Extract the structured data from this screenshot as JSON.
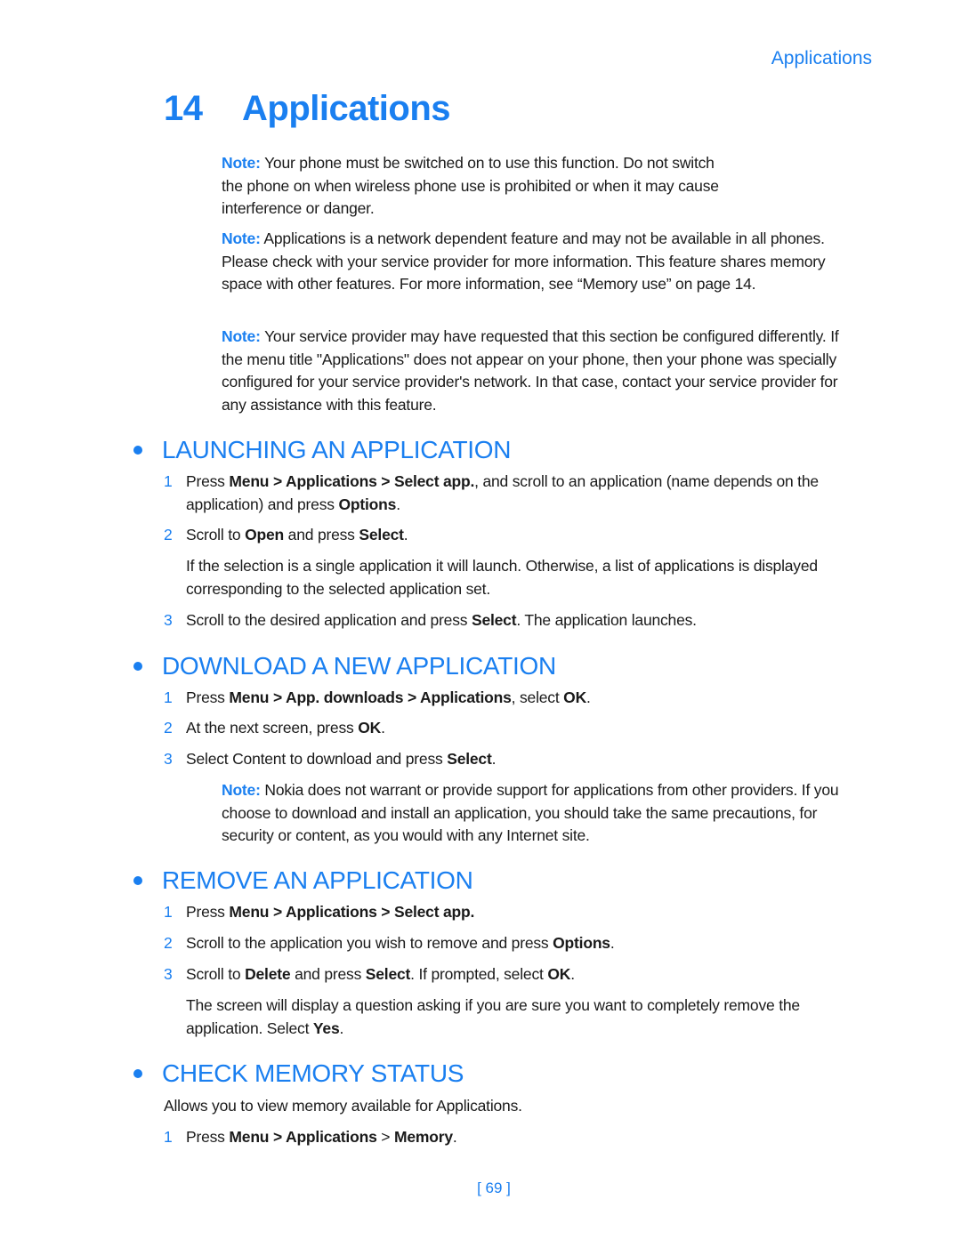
{
  "running_head": "Applications",
  "chapter": {
    "number": "14",
    "title": "Applications"
  },
  "notes_intro": [
    {
      "label": "Note:",
      "text": " Your phone must be switched on to use this function. Do not switch the phone on when wireless phone use is prohibited or when it may cause interference or danger."
    },
    {
      "label": "Note:",
      "text": "  Applications is a network dependent feature and may not be available in all phones. Please check with your service provider for more information. This feature shares memory space with other features. For more information, see “Memory use” on page 14."
    },
    {
      "label": "Note:",
      "text": "  Your service provider may have requested that this section be configured differently. If the menu title \"Applications\" does not appear on your phone, then your phone was specially configured for your service provider's network. In that case, contact your service provider for any assistance with this feature."
    }
  ],
  "sections": {
    "launch": {
      "heading": "LAUNCHING AN APPLICATION",
      "step1": {
        "n": "1",
        "a": "Press ",
        "b1": "Menu",
        "c": " > ",
        "b2": "Applications",
        "d": " > ",
        "b3": "Select app.",
        "e": ", and scroll to an application (name depends on the application) and press ",
        "b4": "Options",
        "f": "."
      },
      "step2": {
        "n": "2",
        "a": "Scroll to ",
        "b1": "Open",
        "c": " and press ",
        "b2": "Select",
        "d": "."
      },
      "para": "If the selection is a single application it will launch. Otherwise, a list of applications is displayed corresponding to the selected application set.",
      "step3": {
        "n": "3",
        "a": "Scroll to the desired application and press ",
        "b1": "Select",
        "c": ". The application launches."
      }
    },
    "download": {
      "heading": "DOWNLOAD A NEW APPLICATION",
      "step1": {
        "n": "1",
        "a": "Press ",
        "b1": "Menu",
        "c": " > ",
        "b2": "App. downloads",
        "d": " > ",
        "b3": "Applications",
        "e": ", select ",
        "b4": "OK",
        "f": "."
      },
      "step2": {
        "n": "2",
        "a": "At the next screen, press ",
        "b1": "OK",
        "c": "."
      },
      "step3": {
        "n": "3",
        "a": "Select Content to download and press ",
        "b1": "Select",
        "c": "."
      },
      "note": {
        "label": "Note:",
        "text": " Nokia does not warrant or provide support for applications from other providers. If you choose to download and install an application, you should take the same precautions, for security or content, as you would with any Internet site."
      }
    },
    "remove": {
      "heading": "REMOVE AN APPLICATION",
      "step1": {
        "n": "1",
        "a": "Press ",
        "b1": "Menu",
        "c": " > ",
        "b2": "Applications",
        "d": " > ",
        "b3": "Select app."
      },
      "step2": {
        "n": "2",
        "a": "Scroll to the application you wish to remove and press ",
        "b1": "Options",
        "c": "."
      },
      "step3": {
        "n": "3",
        "a": "Scroll to ",
        "b1": "Delete",
        "c": " and press ",
        "b2": "Select",
        "d": ". If prompted, select ",
        "b3": "OK",
        "e": "."
      },
      "para": {
        "a": "The screen will display a question asking if you are sure you want to completely remove the application. Select ",
        "b1": "Yes",
        "c": "."
      }
    },
    "memory": {
      "heading": "CHECK MEMORY STATUS",
      "intro": "Allows you to view memory available for Applications.",
      "step1": {
        "n": "1",
        "a": "Press ",
        "b1": "Menu",
        "c": " > ",
        "b2": "Applications",
        "d": " > ",
        "b3": "Memory",
        "e": "."
      }
    }
  },
  "page_number": "[ 69 ]"
}
